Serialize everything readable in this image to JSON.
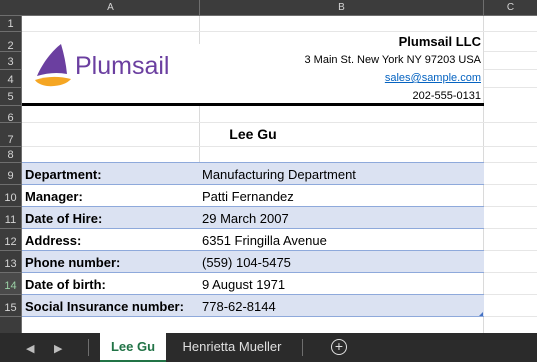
{
  "columns": [
    "A",
    "B",
    "C"
  ],
  "rows": [
    "1",
    "2",
    "3",
    "4",
    "5",
    "6",
    "7",
    "8",
    "9",
    "10",
    "11",
    "12",
    "13",
    "14",
    "15"
  ],
  "company": {
    "name": "Plumsail LLC",
    "address": "3 Main St. New York NY 97203 USA",
    "email": "sales@sample.com",
    "phone": "202-555-0131",
    "logo_text": "Plumsail"
  },
  "employee_name": "Lee Gu",
  "fields": [
    {
      "label": "Department:",
      "value": "Manufacturing Department"
    },
    {
      "label": "Manager:",
      "value": "Patti Fernandez"
    },
    {
      "label": "Date of Hire:",
      "value": "29 March 2007"
    },
    {
      "label": "Address:",
      "value": "6351 Fringilla Avenue"
    },
    {
      "label": "Phone number:",
      "value": "(559) 104-5475"
    },
    {
      "label": "Date of birth:",
      "value": "9 August 1971"
    },
    {
      "label": "Social Insurance number:",
      "value": "778-62-8144"
    }
  ],
  "sheets": [
    "Lee Gu",
    "Henrietta Mueller"
  ],
  "active_sheet": "Lee Gu",
  "colors": {
    "accent": "#217346",
    "band": "#dbe2f2",
    "logo_purple": "#6b3fa0",
    "logo_orange": "#f5a623",
    "link": "#0563c1"
  },
  "icons": {
    "prev": "chevron-left-icon",
    "next": "chevron-right-icon",
    "add_sheet": "plus-circle-icon"
  }
}
